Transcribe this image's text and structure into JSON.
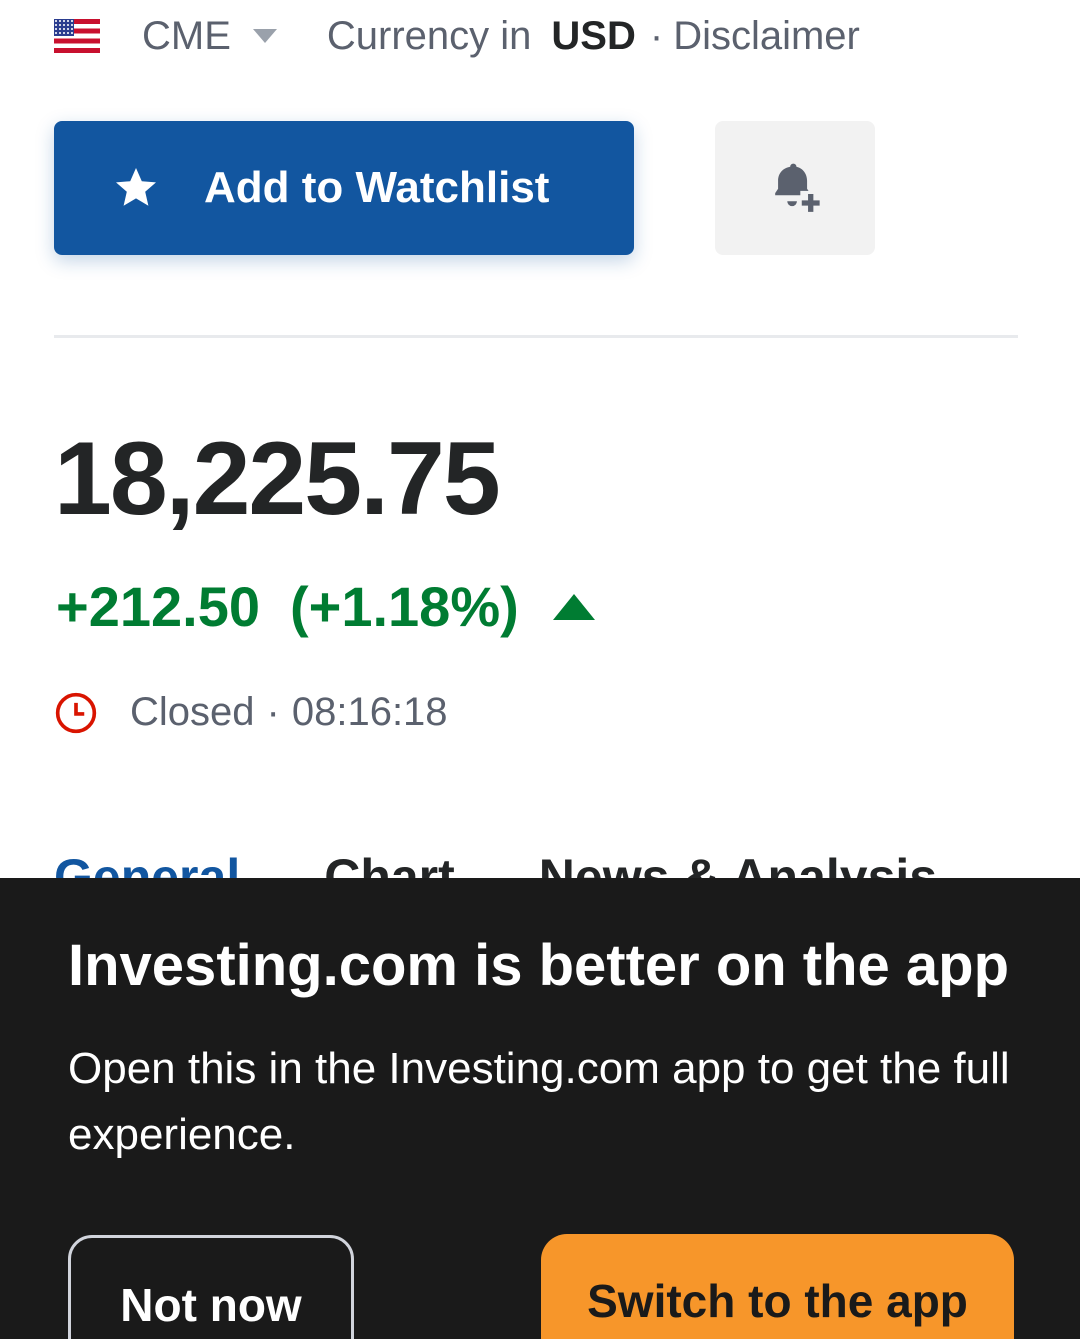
{
  "header": {
    "flag_icon": "us-flag-icon",
    "exchange": "CME",
    "currency_label": "Currency in",
    "currency_code": "USD",
    "separator": "·",
    "disclaimer": "Disclaimer"
  },
  "actions": {
    "watchlist_label": "Add to Watchlist",
    "watchlist_icon": "star-icon",
    "alert_icon": "bell-plus-icon",
    "button_color": "#1256a0"
  },
  "quote": {
    "price": "18,225.75",
    "change": "+212.50",
    "change_pct": "(+1.18%)",
    "direction": "up",
    "change_color": "#007c32",
    "status": "Closed",
    "separator": "·",
    "time": "08:16:18",
    "status_icon": "clock-icon"
  },
  "tabs": [
    {
      "label": "General",
      "active": true
    },
    {
      "label": "Chart",
      "active": false
    },
    {
      "label": "News & Analysis",
      "active": false
    }
  ],
  "app_banner": {
    "title": "Investing.com is better on the app",
    "body": "Open this in the Investing.com app to get the full experience.",
    "not_now_label": "Not now",
    "switch_label": "Switch to the app",
    "switch_color": "#f7962a"
  }
}
